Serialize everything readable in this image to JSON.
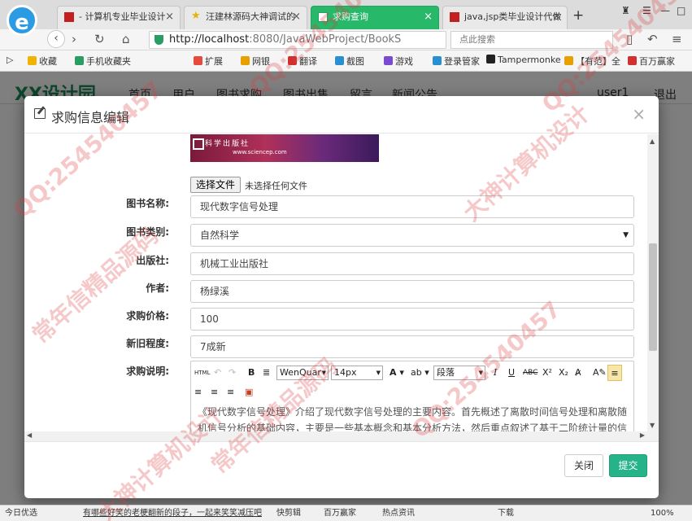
{
  "tabs": [
    {
      "label": "- 计算机专业毕业设计"
    },
    {
      "label": "汪建林源码大神调试的"
    },
    {
      "label": "求购查询"
    },
    {
      "label": "java,jsp类毕业设计代做"
    }
  ],
  "nav": {
    "url_host": "http://localhost",
    "url_rest": ":8080/JavaWebProject/BookS",
    "search_placeholder": "点此搜索"
  },
  "bookmarks": [
    "收藏",
    "手机收藏夹",
    "扩展",
    "网银",
    "翻译",
    "截图",
    "游戏",
    "登录管家",
    "Tampermonke",
    "【有范】全",
    "百万赢家"
  ],
  "site": {
    "logo": "XX设计园",
    "nav": [
      "首页",
      "用户",
      "图书求购",
      "图书出售",
      "留言",
      "新闻公告",
      "user1",
      "退出"
    ]
  },
  "modal": {
    "title": "求购信息编辑",
    "close": "×",
    "cover": {
      "publisher": "科学出版社",
      "url": "www.sciencep.com"
    },
    "file_button": "选择文件",
    "file_status": "未选择任何文件",
    "fields": [
      {
        "label": "图书名称:",
        "value": "现代数字信号处理"
      },
      {
        "label": "图书类别:",
        "value": "自然科学"
      },
      {
        "label": "出版社:",
        "value": "机械工业出版社"
      },
      {
        "label": "作者:",
        "value": "杨绿溪"
      },
      {
        "label": "求购价格:",
        "value": "100"
      },
      {
        "label": "新旧程度:",
        "value": "7成新"
      },
      {
        "label": "求购说明:",
        "value": ""
      }
    ],
    "editor": {
      "font": "WenQuar",
      "size": "14px",
      "paragraph": "段落",
      "content": "《现代数字信号处理》介绍了现代数字信号处理的主要内容。首先概述了离散时间信号处理和离散随机信号分析的基础内容，主要是一些基本概念和基本分析方法，然后重点叙述了基于二阶统计量的信号处理理论和方法，包括随机信号的线性预测、维纳滤波理论、最优线性滤波器与自适应滤波器"
    },
    "buttons": {
      "close": "关闭",
      "submit": "提交"
    }
  },
  "statusbar": {
    "left": "今日优选",
    "news": "有哪些好笑的老梗翻新的段子，一起来笑笑减压吧",
    "items": [
      "快剪辑",
      "百万赢家",
      "热点资讯",
      "下载"
    ],
    "zoom": "100%"
  },
  "watermarks": [
    "QQ:254540457",
    "常年信精品源码",
    "大神计算机设计"
  ]
}
